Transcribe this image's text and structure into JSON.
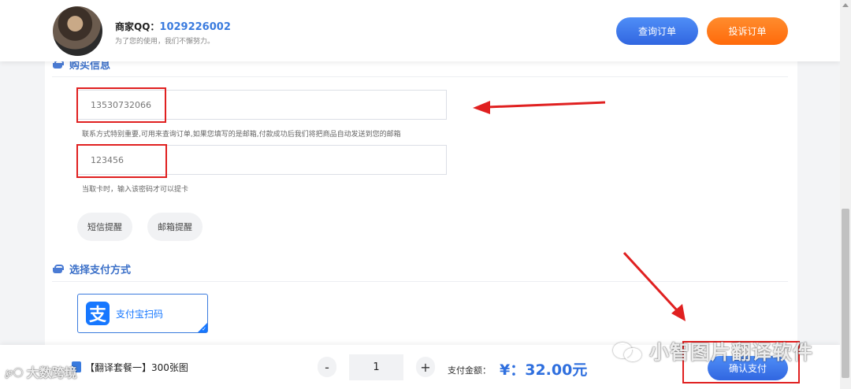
{
  "header": {
    "merchant_label": "商家QQ：",
    "merchant_qq": "1029226002",
    "slogan": "为了您的使用，我们不懈努力。",
    "query_order_label": "查询订单",
    "complain_order_label": "投诉订单"
  },
  "purchase_info": {
    "title": "购买信息",
    "contact_value": "13530732066",
    "contact_hint": "联系方式特别重要,可用来查询订单,如果您填写的是邮箱,付款成功后我们将把商品自动发送到您的邮箱",
    "password_value": "123456",
    "password_hint": "当取卡时，输入该密码才可以提卡",
    "sms_reminder_label": "短信提醒",
    "email_reminder_label": "邮箱提醒"
  },
  "payment": {
    "title": "选择支付方式",
    "alipay_label": "支付宝扫码",
    "alipay_logo_glyph": "支"
  },
  "bottom_bar": {
    "product_name": "【翻译套餐一】300张图",
    "minus_label": "-",
    "quantity": "1",
    "plus_label": "+",
    "amount_label": "支付金额：",
    "amount_value": "¥：32.00元",
    "confirm_pay_label": "确认支付"
  },
  "watermarks": {
    "right_text": "小智图片翻译软件",
    "left_text": "大数跨境"
  },
  "colors": {
    "primary_blue": "#3a7bde",
    "orange": "#ff6a0a",
    "annotation_red": "#e02020",
    "alipay_blue": "#1677ff"
  },
  "icons": {
    "section_icon": "basket-icon",
    "alipay_icon": "alipay-icon",
    "product_icon": "product-icon",
    "wechat_icon": "wechat-icon"
  }
}
